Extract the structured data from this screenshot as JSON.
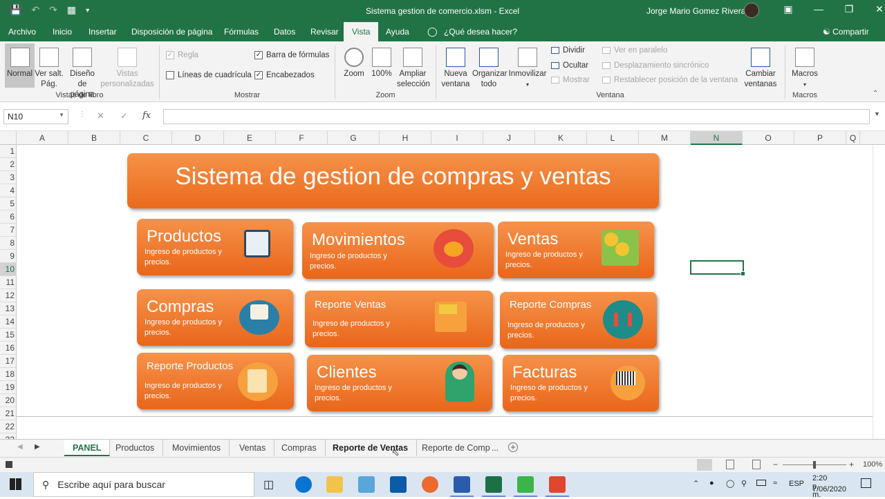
{
  "titlebar": {
    "qat_icons": [
      "save-icon",
      "undo-icon",
      "redo-icon",
      "form-icon",
      "customize-icon"
    ],
    "title": "Sistema gestion de comercio.xlsm  -  Excel",
    "user": "Jorge Mario Gomez Rivera"
  },
  "tabs": [
    {
      "label": "Archivo"
    },
    {
      "label": "Inicio"
    },
    {
      "label": "Insertar"
    },
    {
      "label": "Disposición de página"
    },
    {
      "label": "Fórmulas"
    },
    {
      "label": "Datos"
    },
    {
      "label": "Revisar"
    },
    {
      "label": "Vista",
      "active": true
    },
    {
      "label": "Ayuda"
    },
    {
      "label": "¿Qué desea hacer?"
    }
  ],
  "share_label": "Compartir",
  "ribbon": {
    "workbook_views": {
      "group": "Vistas de libro",
      "normal": "Normal",
      "page_break": "Ver salt.\nPág.",
      "page_layout": "Diseño\nde página",
      "custom": "Vistas\npersonalizadas"
    },
    "show": {
      "group": "Mostrar",
      "ruler": "Regla",
      "formula_bar": "Barra de fórmulas",
      "gridlines": "Líneas de cuadrícula",
      "headings": "Encabezados"
    },
    "zoom": {
      "group": "Zoom",
      "zoom": "Zoom",
      "p100": "100%",
      "selection": "Ampliar\nselección"
    },
    "window": {
      "group": "Ventana",
      "new_window": "Nueva\nventana",
      "arrange": "Organizar\ntodo",
      "freeze": "Inmovilizar",
      "split": "Dividir",
      "hide": "Ocultar",
      "unhide": "Mostrar",
      "side": "Ver en paralelo",
      "sync": "Desplazamiento sincrónico",
      "reset": "Restablecer posición de la ventana",
      "switch": "Cambiar\nventanas"
    },
    "macros": {
      "group": "Macros",
      "macros": "Macros"
    }
  },
  "formula_bar": {
    "name_box": "N10",
    "cancel": "✕",
    "enter": "✓",
    "fx": "fx",
    "value": ""
  },
  "columns": [
    "A",
    "B",
    "C",
    "D",
    "E",
    "F",
    "G",
    "H",
    "I",
    "J",
    "K",
    "L",
    "M",
    "N",
    "O",
    "P",
    "Q"
  ],
  "rows": [
    "1",
    "2",
    "3",
    "4",
    "5",
    "6",
    "7",
    "8",
    "9",
    "10",
    "11",
    "12",
    "13",
    "14",
    "15",
    "16",
    "17",
    "18",
    "19",
    "20",
    "21",
    "22",
    "23"
  ],
  "selected": {
    "column": "N",
    "row": "10"
  },
  "dashboard": {
    "title": "Sistema de gestion de compras y ventas",
    "cards": [
      {
        "title": "Productos",
        "desc": "Ingreso de productos y precios.",
        "icon": "clipboard-icon"
      },
      {
        "title": "Movimientos",
        "desc": "Ingreso de productos y precios.",
        "icon": "piggy-bank-icon"
      },
      {
        "title": "Ventas",
        "desc": "Ingreso de productos y precios.",
        "icon": "money-icon"
      },
      {
        "title": "Compras",
        "desc": "Ingreso de productos y precios.",
        "icon": "handshake-icon"
      },
      {
        "title": "Reporte Ventas",
        "desc": "Ingreso de productos y precios.",
        "icon": "hand-card-icon"
      },
      {
        "title": "Reporte Compras",
        "desc": "Ingreso de productos y precios.",
        "icon": "chart-icon"
      },
      {
        "title": "Reporte Productos",
        "desc": "Ingreso de productos y precios.",
        "icon": "notepad-icon"
      },
      {
        "title": "Clientes",
        "desc": "Ingreso de productos y precios.",
        "icon": "customer-icon"
      },
      {
        "title": "Facturas",
        "desc": "Ingreso de productos y precios.",
        "icon": "barcode-icon"
      }
    ]
  },
  "sheet_tabs": [
    "PANEL",
    "Productos",
    "Movimientos",
    "Ventas",
    "Compras",
    "Reporte de Ventas",
    "Reporte de Comp"
  ],
  "more_tabs": "...",
  "status": {
    "zoom": "100%"
  },
  "taskbar": {
    "search_placeholder": "Escribe aquí para buscar",
    "lang": "ESP",
    "time": "2:20 p. m.",
    "date": "7/06/2020"
  },
  "colors": {
    "excel_green": "#217346",
    "card_orange": "#ef7b30"
  }
}
